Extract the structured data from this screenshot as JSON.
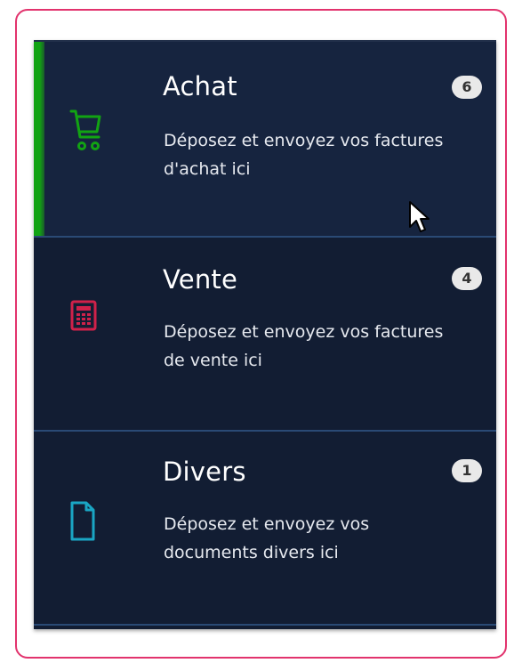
{
  "categories": [
    {
      "title": "Achat",
      "description": "Déposez et envoyez vos factures d'achat ici",
      "count": "6",
      "icon": "shopping-cart-icon",
      "color": "#12a313",
      "active": true
    },
    {
      "title": "Vente",
      "description": "Déposez et envoyez vos factures de vente ici",
      "count": "4",
      "icon": "calculator-icon",
      "color": "#d0214a",
      "active": false
    },
    {
      "title": "Divers",
      "description": "Déposez et envoyez vos documents divers ici",
      "count": "1",
      "icon": "document-icon",
      "color": "#1aa6c4",
      "active": false
    }
  ],
  "colors": {
    "panel_bg": "#121d33",
    "active_bg": "#16243f",
    "divider": "#2a4a75",
    "frame_border": "#e2336d"
  }
}
